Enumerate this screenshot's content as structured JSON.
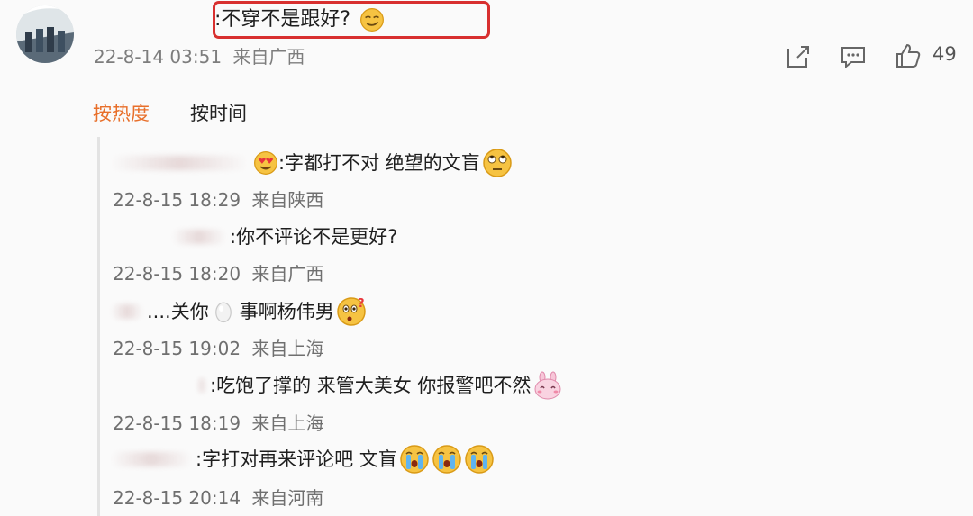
{
  "comment": {
    "text": ":不穿不是跟好?",
    "date": "22-8-14 03:51",
    "location": "来自广西",
    "like_count": "49",
    "emoji": "smirk-emoji"
  },
  "sort_tabs": {
    "hot": "按热度",
    "time": "按时间"
  },
  "colors": {
    "accent": "#e86f2a",
    "highlight": "#d8302f",
    "meta": "#7d7d7d"
  },
  "replies": [
    {
      "text": ":字都打不对 绝望的文盲",
      "date": "22-8-15 18:29",
      "location": "来自陕西",
      "emojis": [
        "heart-eyes-emoji",
        "eye-roll-emoji"
      ]
    },
    {
      "text": ":你不评论不是更好?",
      "date": "22-8-15 18:20",
      "location": "来自广西",
      "emojis": []
    },
    {
      "text_before": "....关你",
      "text_after": "事啊杨伟男",
      "date": "22-8-15 19:02",
      "location": "来自上海",
      "emojis": [
        "egg-emoji",
        "confused-emoji"
      ]
    },
    {
      "text": ":吃饱了撑的 来管大美女 你报警吧不然",
      "date": "22-8-15 18:19",
      "location": "来自上海",
      "emojis": [
        "pink-bunny-emoji"
      ]
    },
    {
      "text": ":字打对再来评论吧 文盲",
      "date": "22-8-15 20:14",
      "location": "来自河南",
      "emojis": [
        "crying-emoji",
        "crying-emoji",
        "crying-emoji"
      ]
    }
  ]
}
